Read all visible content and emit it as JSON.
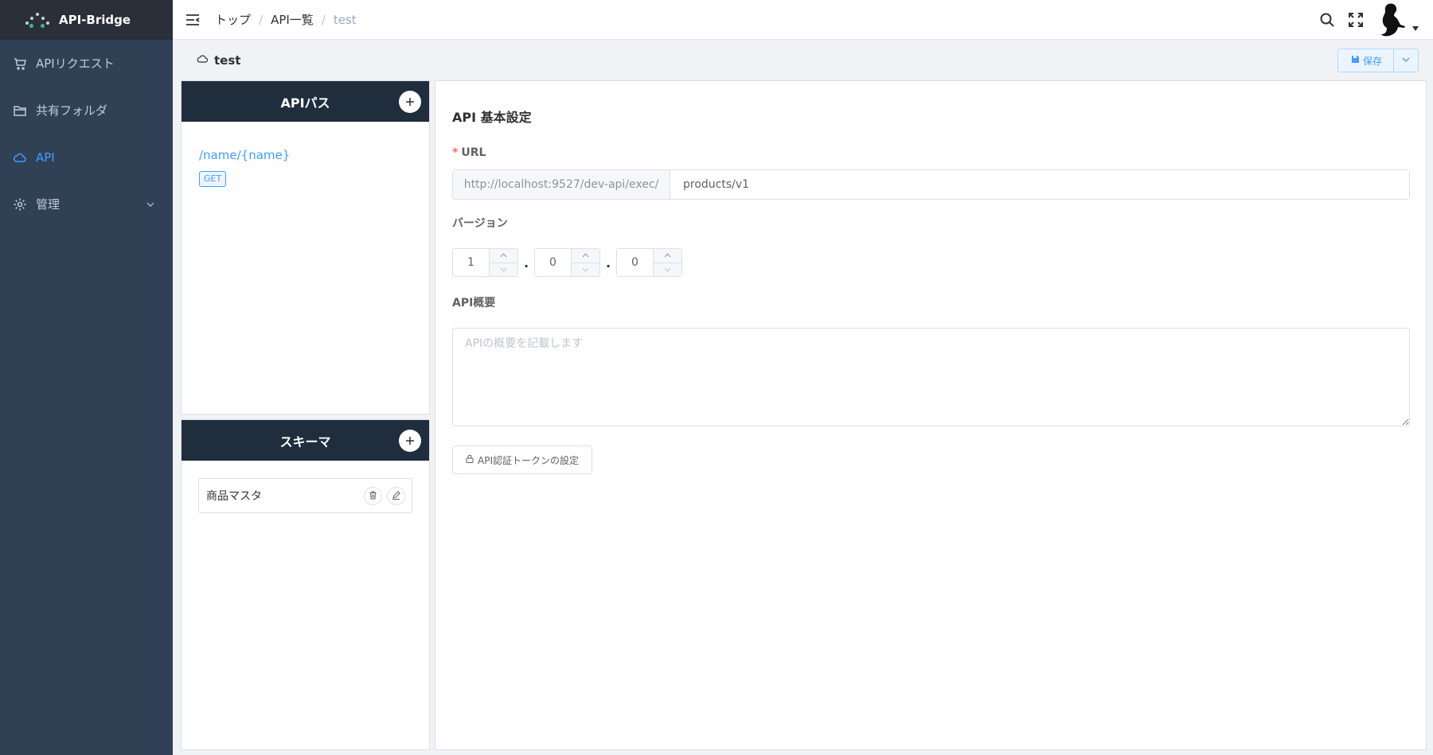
{
  "app": {
    "name": "API-Bridge"
  },
  "sidebar": {
    "items": [
      {
        "label": "APIリクエスト",
        "icon": "cart-icon"
      },
      {
        "label": "共有フォルダ",
        "icon": "folder-icon"
      },
      {
        "label": "API",
        "icon": "cloud-icon",
        "active": true
      },
      {
        "label": "管理",
        "icon": "gear-icon",
        "expandable": true
      }
    ]
  },
  "breadcrumb": [
    "トップ",
    "API一覧",
    "test"
  ],
  "page": {
    "title": "test",
    "save_label": "保存"
  },
  "api_paths": {
    "header": "APIパス",
    "items": [
      {
        "path": "/name/{name}",
        "method": "GET"
      }
    ]
  },
  "schema": {
    "header": "スキーマ",
    "items": [
      {
        "name": "商品マスタ"
      }
    ]
  },
  "settings": {
    "title": "API 基本設定",
    "url": {
      "label": "URL",
      "required_mark": "*",
      "prefix": "http://localhost:9527/dev-api/exec/",
      "value": "products/v1"
    },
    "version": {
      "label": "バージョン",
      "major": "1",
      "minor": "0",
      "patch": "0",
      "separator": "."
    },
    "summary": {
      "label": "API概要",
      "placeholder": "APIの概要を記載します"
    },
    "token_button": "API認証トークンの設定"
  },
  "colors": {
    "sidebar_bg": "#304156",
    "accent": "#409eff",
    "panel_header": "#1f2d3d",
    "required": "#f56c6c"
  }
}
